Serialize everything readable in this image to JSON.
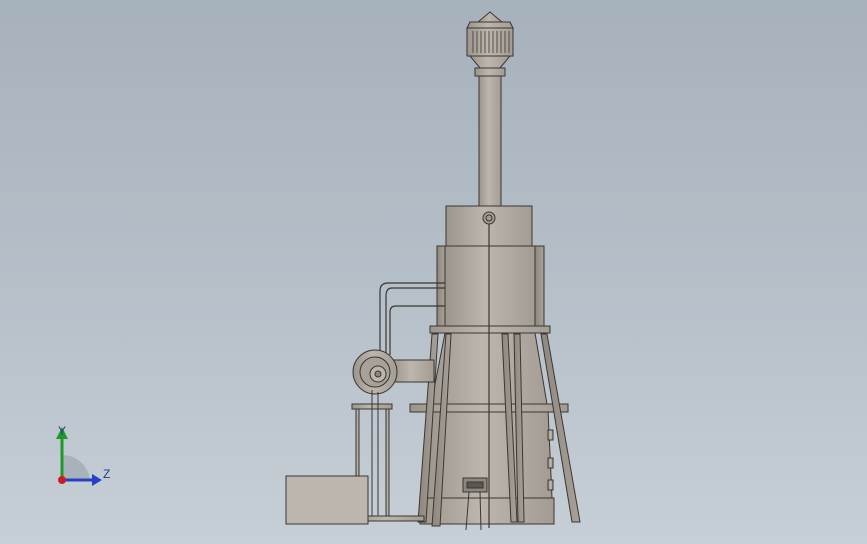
{
  "viewport": {
    "background_top": "#a6b1bb",
    "background_bottom": "#c7cfd6"
  },
  "model": {
    "metal_color": "#b3aca3",
    "outline_color": "#3a3632"
  },
  "triad": {
    "y_label": "Y",
    "z_label": "Z",
    "y_color": "#1f9a2a",
    "z_color": "#2640c8",
    "x_color": "#c81e1e"
  }
}
